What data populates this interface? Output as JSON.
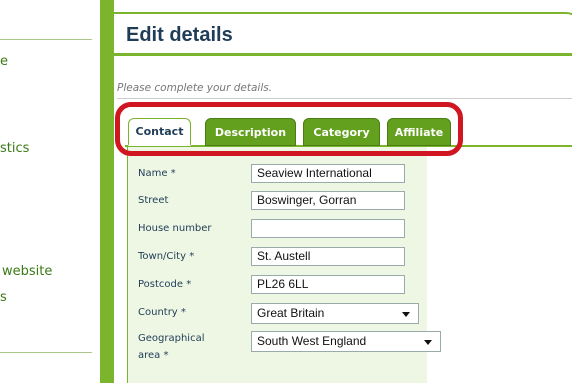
{
  "sidebar": {
    "items": [
      "e",
      "stics",
      "website",
      "s"
    ]
  },
  "header": {
    "title": "Edit details"
  },
  "hint": "Please complete your details.",
  "tabs": [
    {
      "label": "Contact",
      "active": true
    },
    {
      "label": "Description",
      "active": false
    },
    {
      "label": "Category",
      "active": false
    },
    {
      "label": "Affiliate",
      "active": false
    }
  ],
  "form": {
    "name": {
      "label": "Name *",
      "value": "Seaview International"
    },
    "street": {
      "label": "Street",
      "value": "Boswinger, Gorran"
    },
    "house_number": {
      "label": "House number",
      "value": ""
    },
    "town_city": {
      "label": "Town/City *",
      "value": "St. Austell"
    },
    "postcode": {
      "label": "Postcode *",
      "value": "PL26 6LL"
    },
    "country": {
      "label": "Country *",
      "value": "Great Britain"
    },
    "geo_area": {
      "label_line1": "Geographical",
      "label_line2": "area *",
      "value": "South West England"
    }
  },
  "colors": {
    "accent": "#7bb52d",
    "highlight": "#d01620",
    "title": "#1f3d56"
  }
}
